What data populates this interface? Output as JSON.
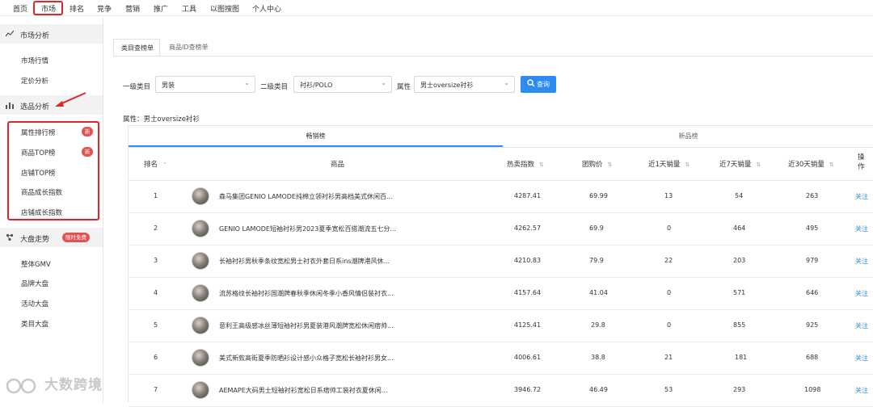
{
  "topnav": {
    "items": [
      "首页",
      "市场",
      "排名",
      "竞争",
      "营销",
      "推广",
      "工具",
      "以图搜图",
      "个人中心"
    ]
  },
  "sidebar": {
    "market_analysis": {
      "label": "市场分析",
      "items": [
        "市场行情",
        "定价分析"
      ]
    },
    "product_selection": {
      "label": "选品分析",
      "items": [
        {
          "label": "属性排行榜",
          "badge": "新"
        },
        {
          "label": "商品TOP榜",
          "badge": "新"
        },
        {
          "label": "店铺TOP榜",
          "badge": ""
        },
        {
          "label": "商品成长指数",
          "badge": ""
        },
        {
          "label": "店铺成长指数",
          "badge": ""
        }
      ]
    },
    "market_trend": {
      "label": "大盘走势",
      "badge": "限时免费",
      "items": [
        "整体GMV",
        "品牌大盘",
        "活动大盘",
        "类目大盘"
      ]
    }
  },
  "tabs": [
    "类目查榜单",
    "商品ID查榜单"
  ],
  "filters": {
    "level1_label": "一级类目",
    "level1_value": "男装",
    "level2_label": "二级类目",
    "level2_value": "衬衫/POLO",
    "attr_label": "属性",
    "attr_value": "男士oversize衬衫",
    "query_button": "查询"
  },
  "attr_text": "属性：男士oversize衬衫",
  "subtabs": [
    "畅销榜",
    "新品榜"
  ],
  "table": {
    "headers": [
      "排名",
      "商品",
      "热卖指数",
      "团购价",
      "近1天销量",
      "近7天销量",
      "近30天销量",
      "操作"
    ],
    "rows": [
      {
        "rank": "1",
        "name": "森马集团GENIO LAMODE纯棉立领衬衫男高档美式休闲百...",
        "hot": "4287.41",
        "price": "69.99",
        "d1": "13",
        "d7": "54",
        "d30": "263",
        "action": "关注"
      },
      {
        "rank": "2",
        "name": "GENIO LAMODE短袖衬衫男2023夏季宽松百搭潮流五七分...",
        "hot": "4262.57",
        "price": "69.9",
        "d1": "0",
        "d7": "464",
        "d30": "495",
        "action": "关注"
      },
      {
        "rank": "3",
        "name": "长袖衬衫男秋季条纹宽松男士衬衣外套日系ins潮牌港风休...",
        "hot": "4210.83",
        "price": "79.9",
        "d1": "22",
        "d7": "203",
        "d30": "979",
        "action": "关注"
      },
      {
        "rank": "4",
        "name": "流苏格纹长袖衬衫国潮牌春秋季休闲冬季小香风情侣装衬衣...",
        "hot": "4157.64",
        "price": "41.04",
        "d1": "0",
        "d7": "571",
        "d30": "646",
        "action": "关注"
      },
      {
        "rank": "5",
        "name": "意利王高级感冰丝薄短袖衬衫男夏装港风潮牌宽松休闲痞帅...",
        "hot": "4125.41",
        "price": "29.8",
        "d1": "0",
        "d7": "855",
        "d30": "925",
        "action": "关注"
      },
      {
        "rank": "6",
        "name": "美式新款高街夏季防晒衫设计感小众格子宽松长袖衬衫男女...",
        "hot": "4006.61",
        "price": "38.8",
        "d1": "21",
        "d7": "181",
        "d30": "688",
        "action": "关注"
      },
      {
        "rank": "7",
        "name": "AEMAPE大码男士短袖衬衫宽松日系痞帅工装衬衣夏休闲...",
        "hot": "3946.72",
        "price": "46.49",
        "d1": "53",
        "d7": "293",
        "d30": "1098",
        "action": "关注"
      }
    ]
  },
  "watermark": "大数跨境"
}
